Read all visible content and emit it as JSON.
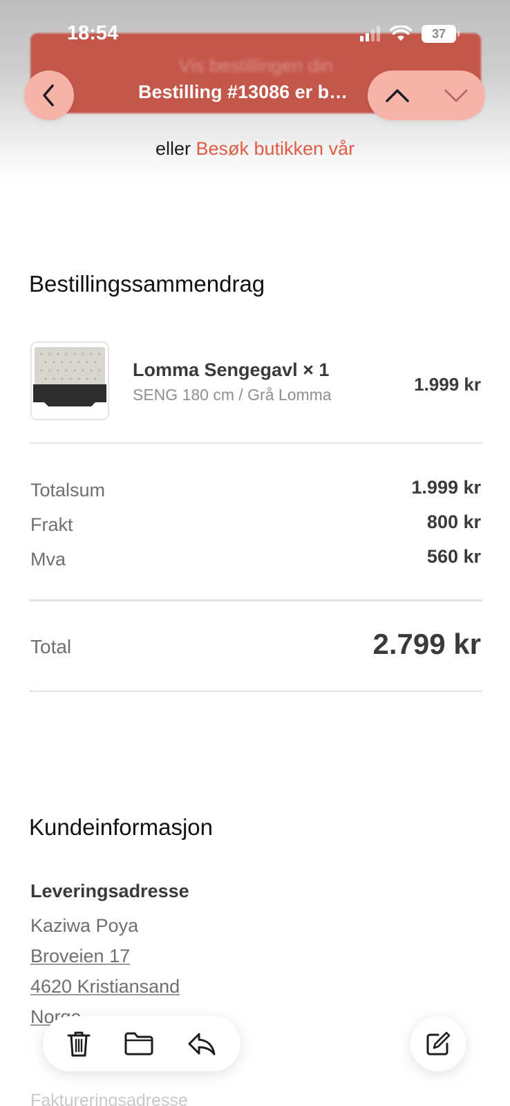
{
  "status_bar": {
    "time": "18:54",
    "battery": "37"
  },
  "header": {
    "cta_blurred": "Vis bestillingen din",
    "title": "Bestilling #13086 er b…",
    "eller_prefix": "eller ",
    "visit_store_link": "Besøk butikken vår"
  },
  "summary": {
    "title": "Bestillingssammendrag",
    "item": {
      "name": "Lomma Sengegavl × 1",
      "variant": "SENG 180 cm / Grå Lomma",
      "price": "1.999 kr"
    },
    "rows": [
      {
        "label": "Totalsum",
        "value": "1.999 kr"
      },
      {
        "label": "Frakt",
        "value": "800 kr"
      },
      {
        "label": "Mva",
        "value": "560 kr"
      }
    ],
    "total_label": "Total",
    "total_value": "2.799 kr"
  },
  "customer": {
    "title": "Kundeinformasjon",
    "shipping_heading": "Leveringsadresse",
    "shipping_lines": [
      "Kaziwa Poya",
      "Broveien 17",
      "4620 Kristiansand",
      "Norge"
    ],
    "billing_heading": "Faktureringsadresse"
  },
  "colors": {
    "accent": "#e05b45",
    "nav_button": "#f7b3a9",
    "cta": "#c5564a"
  },
  "icons": [
    "back-chevron-icon",
    "up-chevron-icon",
    "down-chevron-icon",
    "trash-icon",
    "folder-icon",
    "reply-icon",
    "compose-icon"
  ]
}
